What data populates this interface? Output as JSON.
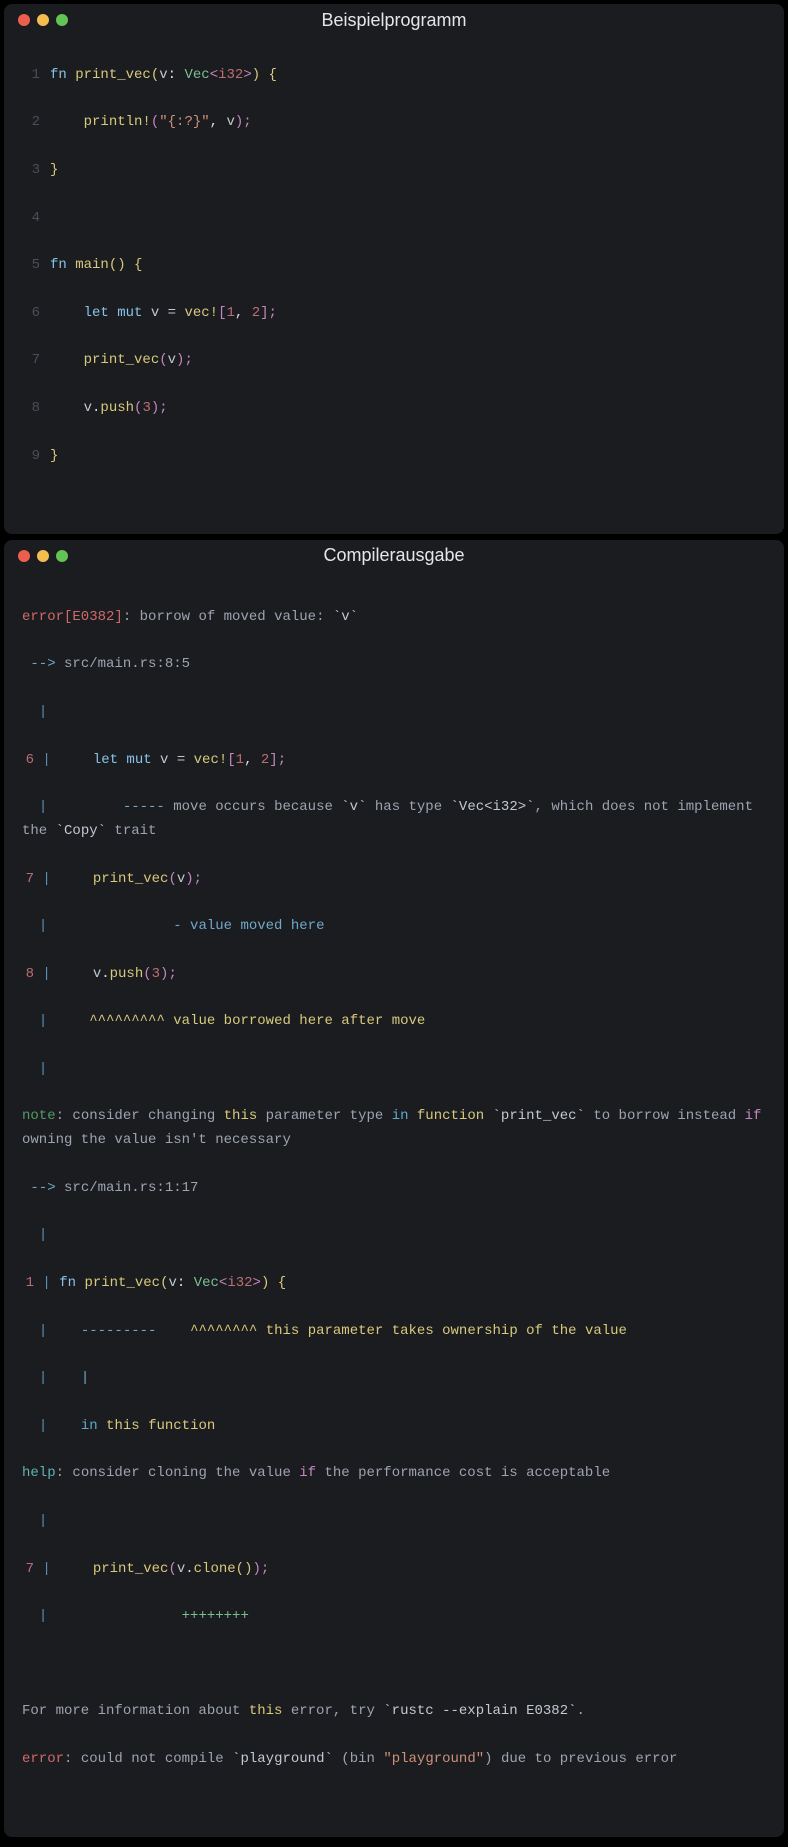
{
  "window1": {
    "title": "Beispielprogramm",
    "lineNumbers": [
      "1",
      "2",
      "3",
      "4",
      "5",
      "6",
      "7",
      "8",
      "9"
    ],
    "code": {
      "l1": {
        "fn": "fn ",
        "name": "print_vec",
        "open": "(",
        "arg": "v",
        "colon": ": ",
        "type": "Vec",
        "lt": "<",
        "inner": "i32",
        "gt": ">",
        "close": ") {",
        "end": ""
      },
      "l2": {
        "indent": "    ",
        "macro": "println!",
        "open": "(",
        "str": "\"{:?}\"",
        "comma": ", ",
        "arg": "v",
        "close": ");"
      },
      "l3": {
        "brace": "}"
      },
      "l4": {
        "blank": ""
      },
      "l5": {
        "fn": "fn ",
        "name": "main",
        "parens": "() {",
        "end": ""
      },
      "l6": {
        "indent": "    ",
        "let": "let ",
        "mut": "mut ",
        "var": "v",
        "eq": " = ",
        "macro": "vec!",
        "open": "[",
        "n1": "1",
        "comma": ", ",
        "n2": "2",
        "close": "];"
      },
      "l7": {
        "indent": "    ",
        "call": "print_vec",
        "open": "(",
        "arg": "v",
        "close": ");"
      },
      "l8": {
        "indent": "    ",
        "obj": "v",
        "dot": ".",
        "method": "push",
        "open": "(",
        "n": "3",
        "close": ");"
      },
      "l9": {
        "brace": "}"
      }
    }
  },
  "window2": {
    "title": "Compilerausgabe",
    "lines": {
      "errHead": {
        "err": "error[E0382]",
        "colon": ": ",
        "msg1": "borrow of moved value: ",
        "tick": "`v`"
      },
      "arrow1": {
        "arrow": " --> ",
        "path": "src/main.rs:8:5"
      },
      "pipe1": "  |",
      "l6": {
        "ln": "6",
        "pipe": " |     ",
        "let": "let ",
        "mut": "mut ",
        "var": "v",
        "eq": " = ",
        "macro": "vec!",
        "open": "[",
        "n1": "1",
        "comma": ", ",
        "n2": "2",
        "close": "];"
      },
      "l6note": {
        "pipe": "  |         ",
        "dash": "-----",
        "sp": " ",
        "msg_a": "move occurs because ",
        "tick1": "`v`",
        "msg_b": " has type ",
        "tick2": "`Vec<i32>`",
        "msg_c": ", which does not implement the ",
        "tick3": "`Copy`",
        "msg_d": " trait"
      },
      "l7": {
        "ln": "7",
        "pipe": " |     ",
        "call": "print_vec",
        "open": "(",
        "arg": "v",
        "close": ");"
      },
      "l7note": {
        "pipe": "  |               ",
        "dash": "-",
        "sp": " ",
        "msg": "value moved here"
      },
      "l8": {
        "ln": "8",
        "pipe": " |     ",
        "obj": "v",
        "dot": ".",
        "method": "push",
        "open": "(",
        "n": "3",
        "close": ");"
      },
      "l8note": {
        "pipe": "  |     ",
        "caret": "^^^^^^^^^",
        "sp": " ",
        "msg": "value borrowed here after move"
      },
      "pipe2": "  |",
      "noteHead": {
        "kw": "note",
        "colon": ": ",
        "a": "consider changing ",
        "this": "this",
        "b": " parameter type ",
        "in": "in",
        "sp": " ",
        "fn": "function",
        "c": " ",
        "tick": "`print_vec`",
        "d": " to borrow instead ",
        "if": "if",
        "e": " owning the value isn't necessary"
      },
      "arrow2": {
        "arrow": " --> ",
        "path": "src/main.rs:1:17"
      },
      "pipe3": "  |",
      "l1": {
        "ln": "1",
        "pipe": " | ",
        "fn": "fn ",
        "name": "print_vec",
        "open": "(",
        "arg": "v",
        "colon": ": ",
        "type": "Vec",
        "lt": "<",
        "inner": "i32",
        "gt": ">",
        "close": ") {"
      },
      "l1note1": {
        "pipe": "  |    ",
        "dash": "---------",
        "gap": "    ",
        "caret": "^^^^^^^^",
        "sp": " ",
        "this": "this",
        "msg": " parameter takes ownership of the value"
      },
      "l1note2": {
        "pipe": "  |    ",
        "bar": "|"
      },
      "l1note3": {
        "pipe": "  |    ",
        "in": "in",
        "sp": " ",
        "this": "this",
        "sp2": " ",
        "fn": "function"
      },
      "helpHead": {
        "kw": "help",
        "colon": ": ",
        "a": "consider cloning the value ",
        "if": "if",
        "b": " the performance cost is acceptable"
      },
      "pipe4": "  |",
      "l7b": {
        "ln": "7",
        "pipe": " |     ",
        "call": "print_vec",
        "open": "(",
        "arg": "v",
        "dot": ".",
        "clone": "clone",
        "p": "()",
        "close": ");"
      },
      "plusline": {
        "pipe": "  |                ",
        "plus": "++++++++"
      },
      "blank": "",
      "footer1": {
        "a": "For more information about ",
        "this": "this",
        "b": " error, try ",
        "tick": "`rustc --explain E0382`",
        "dot": "."
      },
      "footer2": {
        "err": "error",
        "colon": ": ",
        "a": "could not compile ",
        "tick1": "`playground`",
        "b": " (bin ",
        "q": "\"playground\"",
        "c": ") due to previous error"
      }
    }
  }
}
